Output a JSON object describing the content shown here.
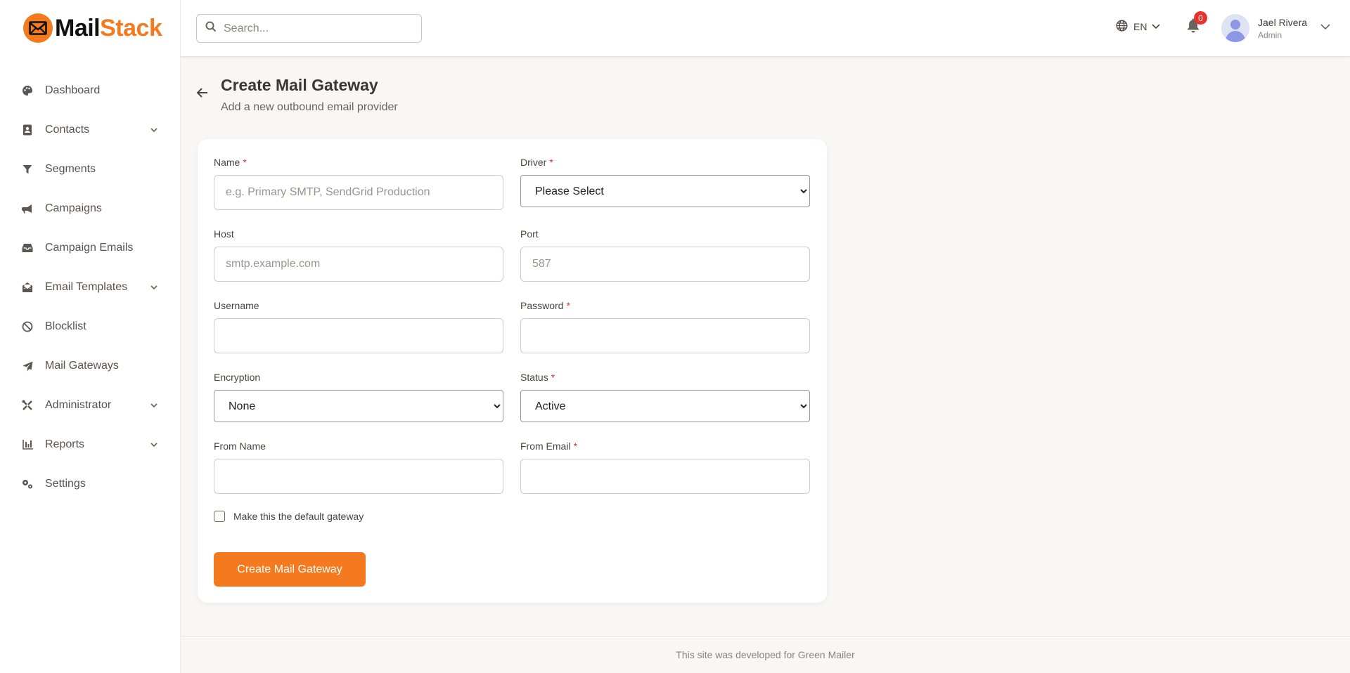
{
  "brand": {
    "part1": "Mail",
    "part2": "Stack",
    "accent": "#f57a1f"
  },
  "sidebar": {
    "items": [
      {
        "label": "Dashboard",
        "icon": "palette-icon",
        "has_children": false
      },
      {
        "label": "Contacts",
        "icon": "address-book-icon",
        "has_children": true
      },
      {
        "label": "Segments",
        "icon": "filter-icon",
        "has_children": false
      },
      {
        "label": "Campaigns",
        "icon": "megaphone-icon",
        "has_children": false
      },
      {
        "label": "Campaign Emails",
        "icon": "inbox-icon",
        "has_children": false
      },
      {
        "label": "Email Templates",
        "icon": "envelope-open-icon",
        "has_children": true
      },
      {
        "label": "Blocklist",
        "icon": "ban-icon",
        "has_children": false
      },
      {
        "label": "Mail Gateways",
        "icon": "paper-plane-icon",
        "has_children": false
      },
      {
        "label": "Administrator",
        "icon": "tools-icon",
        "has_children": true
      },
      {
        "label": "Reports",
        "icon": "bar-chart-icon",
        "has_children": true
      },
      {
        "label": "Settings",
        "icon": "gears-icon",
        "has_children": false
      }
    ]
  },
  "header": {
    "search_placeholder": "Search...",
    "language": "EN",
    "notification_count": "0",
    "user": {
      "name": "Jael Rivera",
      "role": "Admin"
    }
  },
  "page": {
    "title": "Create Mail Gateway",
    "subtitle": "Add a new outbound email provider"
  },
  "form": {
    "name": {
      "label": "Name",
      "placeholder": "e.g. Primary SMTP, SendGrid Production",
      "required": true
    },
    "driver": {
      "label": "Driver",
      "selected": "Please Select",
      "required": true
    },
    "host": {
      "label": "Host",
      "placeholder": "smtp.example.com"
    },
    "port": {
      "label": "Port",
      "placeholder": "587"
    },
    "username": {
      "label": "Username"
    },
    "password": {
      "label": "Password",
      "required": true
    },
    "encryption": {
      "label": "Encryption",
      "selected": "None"
    },
    "status": {
      "label": "Status",
      "selected": "Active",
      "required": true
    },
    "from_name": {
      "label": "From Name"
    },
    "from_email": {
      "label": "From Email",
      "required": true
    },
    "default_checkbox_label": "Make this the default gateway",
    "submit_label": "Create Mail Gateway"
  },
  "footer": {
    "text": "This site was developed for Green Mailer"
  }
}
